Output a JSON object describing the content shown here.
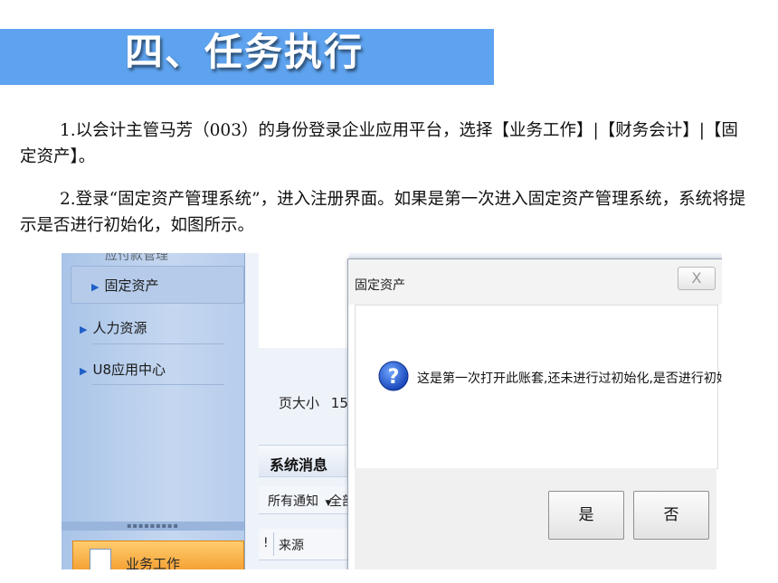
{
  "slide": {
    "title": "四、任务执行",
    "paragraph1": "1.以会计主管马芳（003）的身份登录企业应用平台，选择【业务工作】|【财务会计】|【固定资产】。",
    "paragraph2": "2.登录“固定资产管理系统”，进入注册界面。如果是第一次进入固定资产管理系统，系统将提示是否进行初始化，如图所示。"
  },
  "sidebar": {
    "cut_text": "应付款管理",
    "items": [
      {
        "label": "固定资产"
      },
      {
        "label": "人力资源"
      },
      {
        "label": "U8应用中心"
      }
    ],
    "business_button": "业务工作"
  },
  "main": {
    "page_size_label": "页大小",
    "page_size_value": "15",
    "messages_title": "系统消息",
    "filter_label": "所有通知",
    "filter_all": "全部",
    "column_flag": "!",
    "column_source": "来源"
  },
  "dialog": {
    "title": "固定资产",
    "close_glyph": "X",
    "message": "这是第一次打开此账套,还未进行过初始化,是否进行初始化?",
    "yes_label": "是",
    "no_label": "否"
  },
  "colors": {
    "title_band": "#5ea3ef",
    "sidebar": "#b7cdec",
    "business_button": "#f39c2c"
  }
}
